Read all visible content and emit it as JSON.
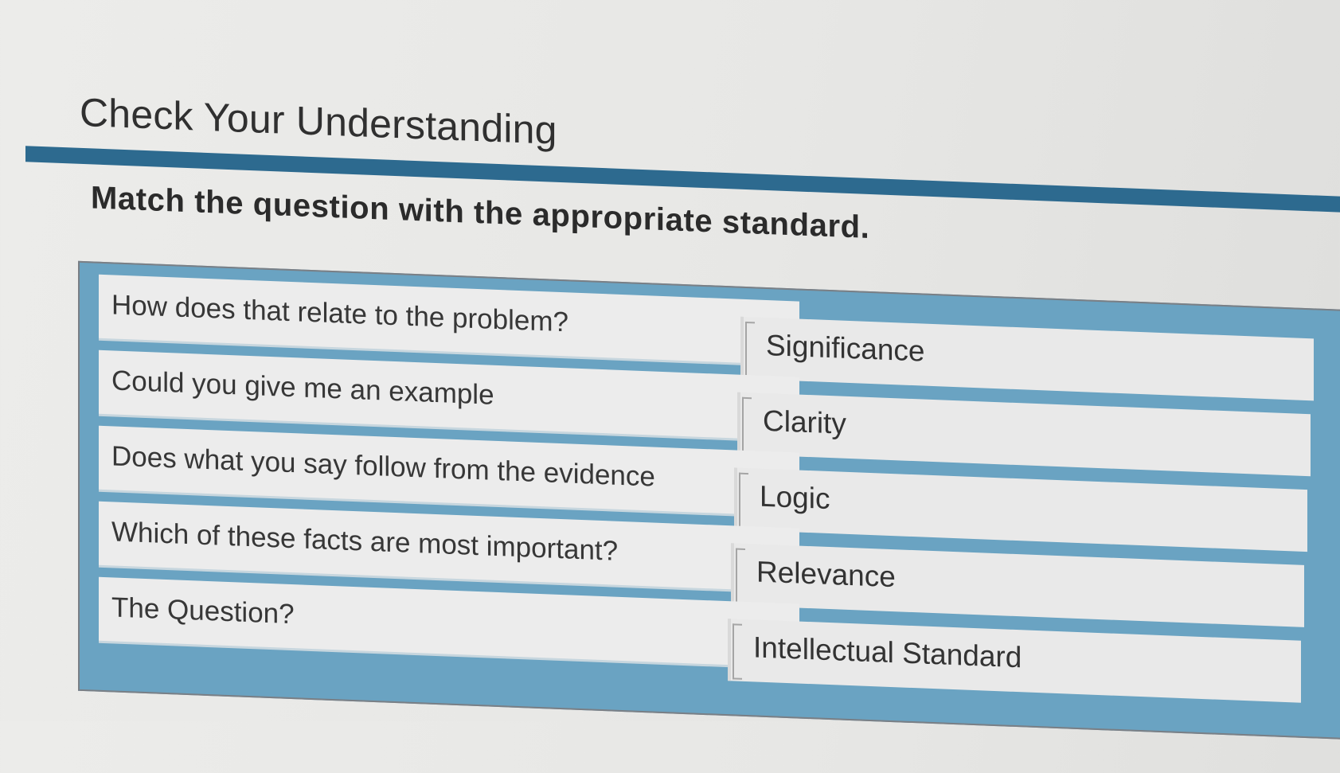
{
  "page": {
    "title": "Check Your Understanding",
    "instruction": "Match the question with the appropriate standard."
  },
  "matching": {
    "questions": [
      "How does that relate to the problem?",
      "Could you give me an example",
      "Does what you say follow from the evidence",
      "Which of these facts are most important?",
      "The Question?"
    ],
    "answers": [
      "Significance",
      "Clarity",
      "Logic",
      "Relevance",
      "Intellectual Standard"
    ]
  },
  "colors": {
    "accent_rule": "#2d6a8f",
    "panel_background": "#6aa3c2",
    "tile_background": "#ececec"
  }
}
